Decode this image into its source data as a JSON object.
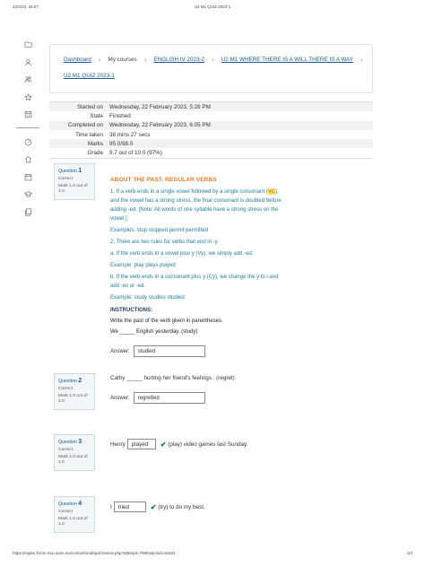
{
  "print": {
    "datetime": "22/2/23, 18:07",
    "page_title": "U2 M1 QUIZ 2023-1",
    "url": "https://ingles.fcmm.ma.unam.mx/cursos/mod/quiz/review.php?attempt=76961&cmid=61521",
    "page_num": "1/4"
  },
  "nav": {
    "icons": [
      "folder-icon",
      "user-icon",
      "users-icon",
      "star-icon",
      "calendar-icon",
      "gauge-icon",
      "home-icon",
      "calendar-icon",
      "graduation-cap-icon",
      "files-icon"
    ]
  },
  "breadcrumb": {
    "items": [
      "Dashboard",
      "My courses",
      "ENGLISH IV 2023-2",
      "U2 M1 WHERE THERE IS A WILL THERE IS A WAY",
      "U2 M1 QUIZ 2023-1"
    ]
  },
  "summary": [
    {
      "label": "Started on",
      "value": "Wednesday, 22 February 2023, 5:28 PM"
    },
    {
      "label": "State",
      "value": "Finished"
    },
    {
      "label": "Completed on",
      "value": "Wednesday, 22 February 2023, 6:05 PM"
    },
    {
      "label": "Time taken",
      "value": "38 mins 27 secs"
    },
    {
      "label": "Marks",
      "value": "95.0/98.0"
    },
    {
      "label": "Grade",
      "value": "9.7 out of 10.0 (97%)"
    }
  ],
  "questions": [
    {
      "label": "Question",
      "number": "1",
      "state": "Correct",
      "grade": "Mark 1.0 out of 1.0"
    },
    {
      "label": "Question",
      "number": "2",
      "state": "Correct",
      "grade": "Mark 1.0 out of 1.0"
    },
    {
      "label": "Question",
      "number": "3",
      "state": "Correct",
      "grade": "Mark 1.0 out of 1.0"
    },
    {
      "label": "Question",
      "number": "4",
      "state": "Correct",
      "grade": "Mark 1.0 out of 1.0"
    }
  ],
  "q1": {
    "title": "ABOUT THE PAST. REGULAR VERBS",
    "rule1_a": "1. If a verb ends in a single vowel followed by a single consonant (",
    "rule1_hl": "VC",
    "rule1_b": "),",
    "rule1_c": "and the vowel has a strong stress, the final consonant is doubled before",
    "rule1_d": "adding -ed. [Note: All words of one syllable have a strong stress on the",
    "rule1_e": "vowel.]",
    "example1": "Examples: stop stopped permit permitted",
    "rule2": "2. There are two rules for verbs that end in -y.",
    "rule2a": "a. If the verb ends in a vowel plus y (Vy), we simply add -ed.",
    "example2": "Example: play plays played",
    "rule2b_1": "b. If the verb ends in a consonant plus y (Cy), we change the y to i and",
    "rule2b_2": "add -es or -ed.",
    "example3": "Example: study studies studied",
    "instructions_title": "INSTRUCTIONS:",
    "instructions": "Write the past of the verb  given in parentheses.",
    "prompt_a": "We",
    "prompt_blank": "_____",
    "prompt_b": "English yesterday. (study)",
    "answer_label": "Answer:",
    "answer": "studied"
  },
  "q2": {
    "prompt_a": "Cathy",
    "prompt_blank": "_____",
    "prompt_b": "hurting her friend's feelings . (regret)",
    "answer_label": "Answer:",
    "answer": "regretted"
  },
  "q3": {
    "prompt_a": "Henry",
    "selected": "played",
    "prompt_b": "(play) video games last Sunday."
  },
  "q4": {
    "prompt_a": "I",
    "selected": "tried",
    "prompt_b": "(try) to do my best."
  }
}
